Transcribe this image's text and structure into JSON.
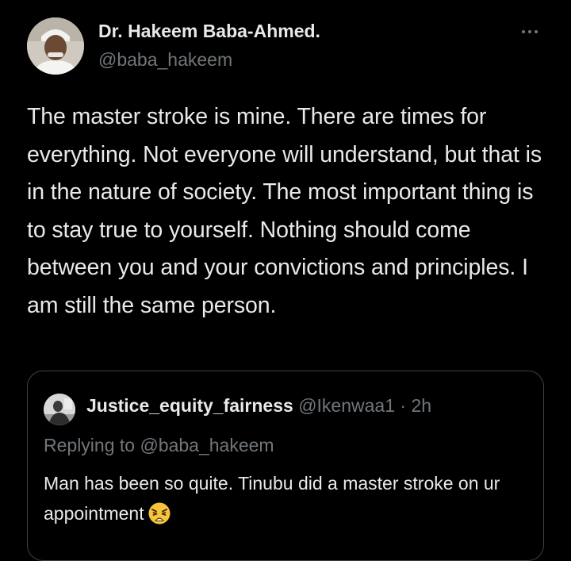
{
  "tweet": {
    "author": {
      "display_name": "Dr. Hakeem Baba-Ahmed.",
      "handle": "@baba_hakeem",
      "avatar_icon": "profile-photo-avatar"
    },
    "more_icon": "more-horizontal-icon",
    "text": "The master stroke is mine. There are times for everything. Not everyone will understand, but that is in the nature of society. The most important thing is to stay true to yourself. Nothing should come between you and your convictions and principles. I am still the same person."
  },
  "quoted_tweet": {
    "author": {
      "display_name": "Justice_equity_fairness",
      "handle": "@Ikenwaa1",
      "separator": " · ",
      "time": "2h",
      "avatar_icon": "profile-photo-avatar"
    },
    "replying_to": "Replying to @baba_hakeem",
    "text": "Man has been so quite. Tinubu did a master stroke on ur appointment",
    "emoji": "weary-face-emoji"
  },
  "colors": {
    "background": "#000000",
    "primary_text": "#e7e9ea",
    "secondary_text": "#71767b",
    "border": "#3c4146",
    "emoji_yellow": "#f8c53a"
  }
}
